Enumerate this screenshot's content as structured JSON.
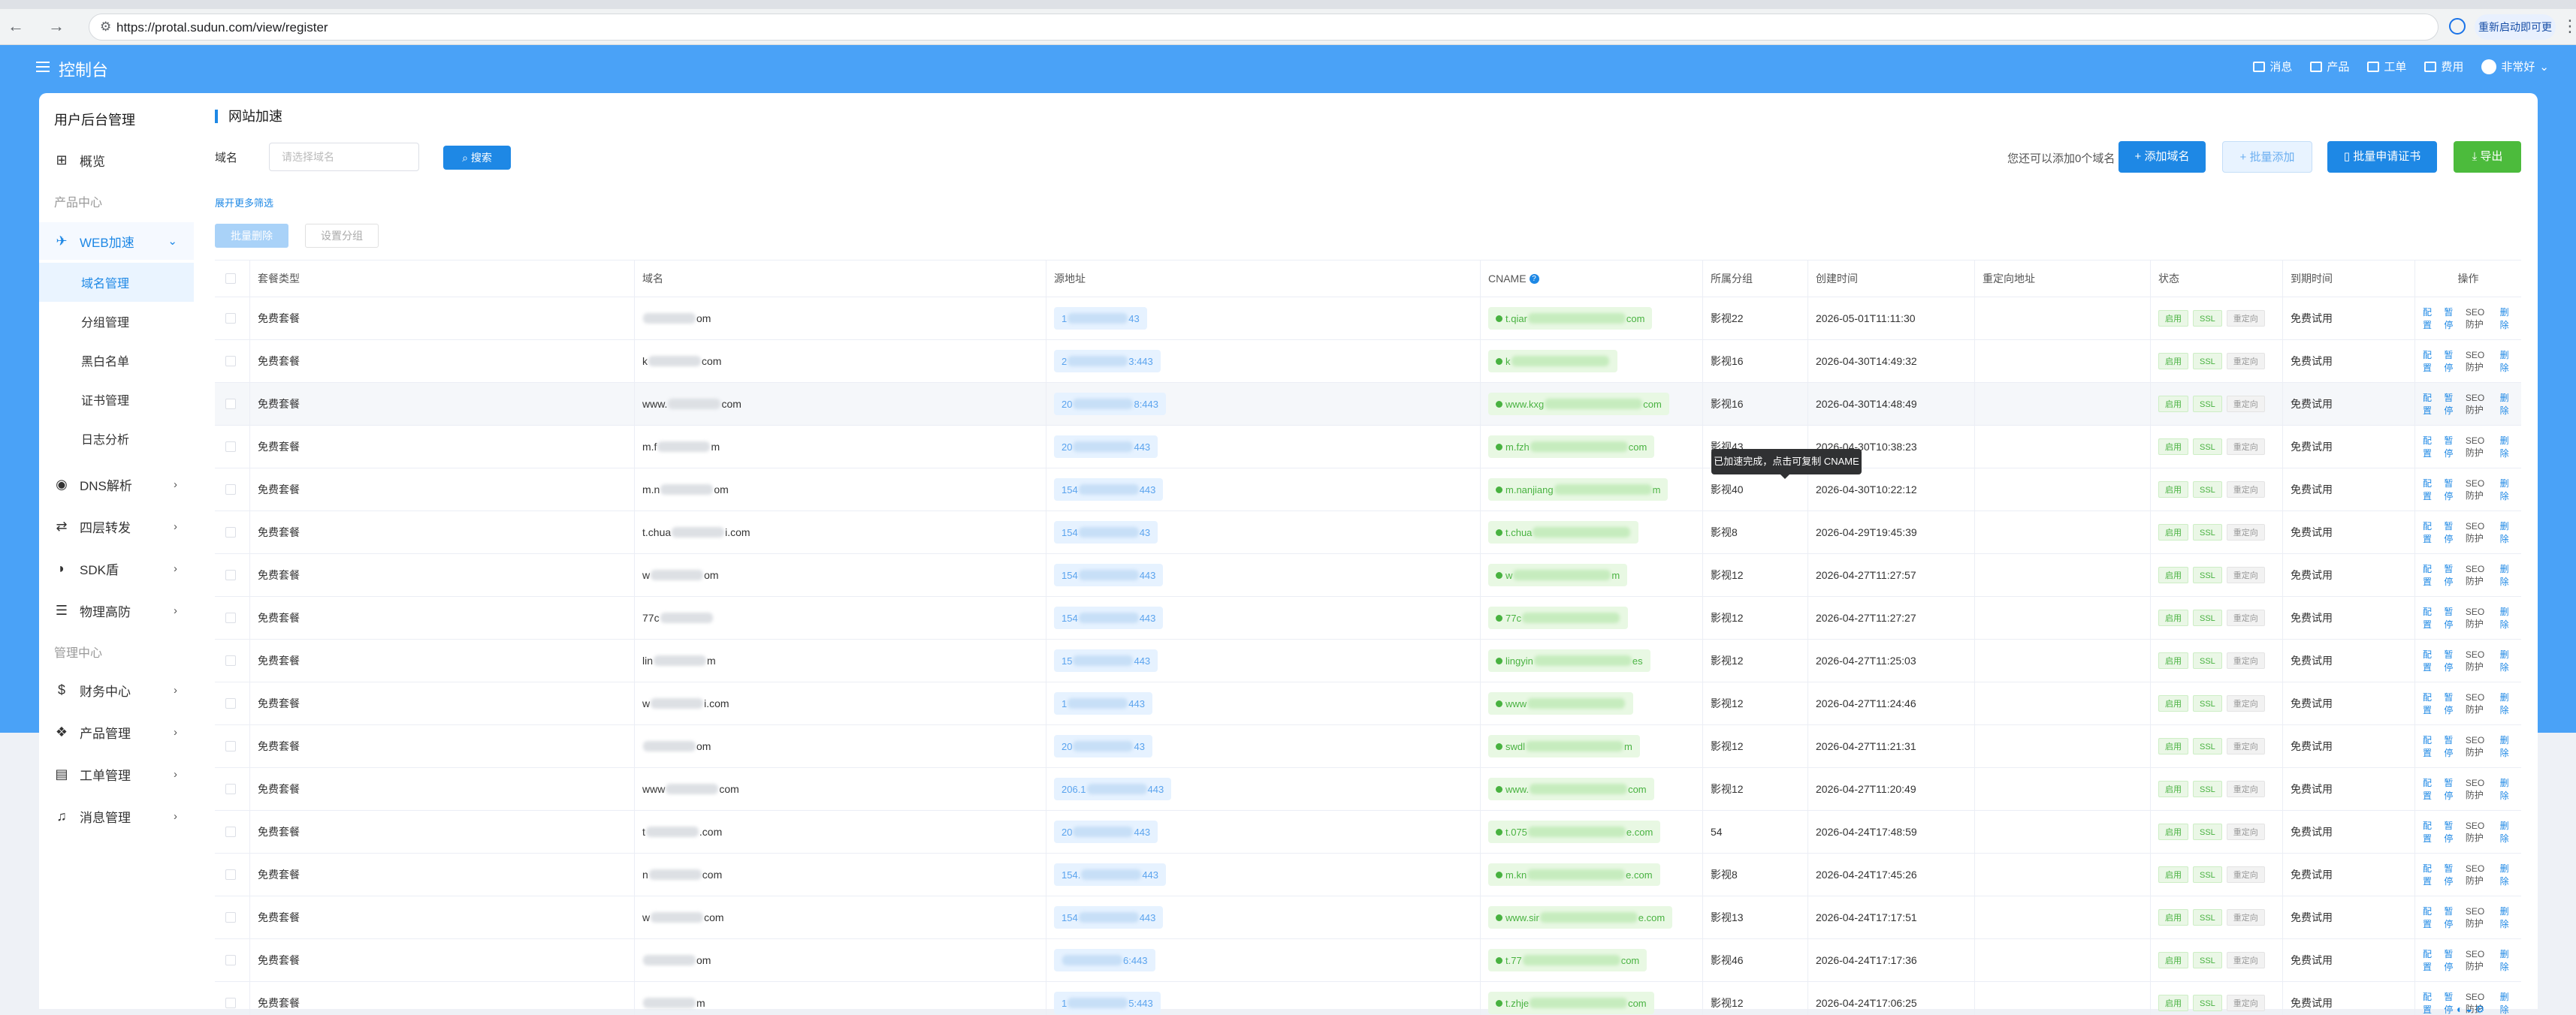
{
  "browser": {
    "url": "https://protal.sudun.com/view/register",
    "update_button": "重新启动即可更新"
  },
  "header": {
    "app_title": "控制台",
    "menu": [
      {
        "label": "消息",
        "icon": "mail-icon"
      },
      {
        "label": "产品",
        "icon": "product-icon"
      },
      {
        "label": "工单",
        "icon": "ticket-icon"
      },
      {
        "label": "费用",
        "icon": "fee-icon"
      },
      {
        "label": "非常好",
        "icon": "user-avatar"
      }
    ]
  },
  "sidebar": {
    "title": "用户后台管理",
    "overview": "概览",
    "section_products": "产品中心",
    "web_accel": "WEB加速",
    "web_sub": [
      "域名管理",
      "分组管理",
      "黑白名单",
      "证书管理",
      "日志分析"
    ],
    "dns": "DNS解析",
    "l4": "四层转发",
    "sdk": "SDK盾",
    "phys": "物理高防",
    "section_mgmt": "管理中心",
    "finance": "财务中心",
    "product_mgmt": "产品管理",
    "ticket_mgmt": "工单管理",
    "msg_mgmt": "消息管理"
  },
  "main": {
    "title": "网站加速",
    "filter_label": "域名",
    "search_placeholder": "请选择域名",
    "search_button": "搜索",
    "more_filter": "展开更多筛选",
    "quota_text": "您还可以添加0个域名",
    "add_domain": "添加域名",
    "batch_add": "批量添加",
    "batch_cert": "批量申请证书",
    "export": "导出",
    "batch_delete": "批量删除",
    "set_group": "设置分组",
    "tooltip": "已加速完成，点击可复制 CNAME"
  },
  "table": {
    "headers": [
      "套餐类型",
      "域名",
      "源地址",
      "CNAME",
      "所属分组",
      "创建时间",
      "重定向地址",
      "状态",
      "到期时间",
      "操作"
    ],
    "status_tags": [
      "启用",
      "SSL",
      "重定向"
    ],
    "ops": [
      "配置",
      "暂停",
      "SEO防护",
      "删除"
    ],
    "rows": [
      {
        "plan": "免费套餐",
        "domain_pre": "",
        "domain_suf": "om",
        "origin_pre": "1",
        "origin_suf": "43",
        "cname_pre": "t.qiar",
        "cname_suf": "com",
        "group": "影视22",
        "created": "2026-05-01T11:11:30",
        "expiry": "免费试用"
      },
      {
        "plan": "免费套餐",
        "domain_pre": "k",
        "domain_suf": "com",
        "origin_pre": "2",
        "origin_suf": "3:443",
        "cname_pre": "k",
        "cname_suf": "",
        "group": "影视16",
        "created": "2026-04-30T14:49:32",
        "expiry": "免费试用"
      },
      {
        "plan": "免费套餐",
        "domain_pre": "www.",
        "domain_suf": "com",
        "origin_pre": "20",
        "origin_suf": "8:443",
        "cname_pre": "www.kxg",
        "cname_suf": "com",
        "group": "影视16",
        "created": "2026-04-30T14:48:49",
        "expiry": "免费试用"
      },
      {
        "plan": "免费套餐",
        "domain_pre": "m.f",
        "domain_suf": "m",
        "origin_pre": "20",
        "origin_suf": "443",
        "cname_pre": "m.fzh",
        "cname_suf": "com",
        "group": "影视43",
        "created": "2026-04-30T10:38:23",
        "expiry": "免费试用"
      },
      {
        "plan": "免费套餐",
        "domain_pre": "m.n",
        "domain_suf": "om",
        "origin_pre": "154",
        "origin_suf": "443",
        "cname_pre": "m.nanjiang",
        "cname_suf": "m",
        "group": "影视40",
        "created": "2026-04-30T10:22:12",
        "expiry": "免费试用"
      },
      {
        "plan": "免费套餐",
        "domain_pre": "t.chua",
        "domain_suf": "i.com",
        "origin_pre": "154",
        "origin_suf": "43",
        "cname_pre": "t.chua",
        "cname_suf": "",
        "group": "影视8",
        "created": "2026-04-29T19:45:39",
        "expiry": "免费试用"
      },
      {
        "plan": "免费套餐",
        "domain_pre": "w",
        "domain_suf": "om",
        "origin_pre": "154",
        "origin_suf": "443",
        "cname_pre": "w",
        "cname_suf": "m",
        "group": "影视12",
        "created": "2026-04-27T11:27:57",
        "expiry": "免费试用"
      },
      {
        "plan": "免费套餐",
        "domain_pre": "77c",
        "domain_suf": "",
        "origin_pre": "154",
        "origin_suf": "443",
        "cname_pre": "77c",
        "cname_suf": "",
        "group": "影视12",
        "created": "2026-04-27T11:27:27",
        "expiry": "免费试用"
      },
      {
        "plan": "免费套餐",
        "domain_pre": "lin",
        "domain_suf": "m",
        "origin_pre": "15",
        "origin_suf": "443",
        "cname_pre": "lingyin",
        "cname_suf": "es",
        "group": "影视12",
        "created": "2026-04-27T11:25:03",
        "expiry": "免费试用"
      },
      {
        "plan": "免费套餐",
        "domain_pre": "w",
        "domain_suf": "i.com",
        "origin_pre": "1",
        "origin_suf": "443",
        "cname_pre": "www",
        "cname_suf": "",
        "group": "影视12",
        "created": "2026-04-27T11:24:46",
        "expiry": "免费试用"
      },
      {
        "plan": "免费套餐",
        "domain_pre": "",
        "domain_suf": "om",
        "origin_pre": "20",
        "origin_suf": "43",
        "cname_pre": "swdl",
        "cname_suf": "m",
        "group": "影视12",
        "created": "2026-04-27T11:21:31",
        "expiry": "免费试用"
      },
      {
        "plan": "免费套餐",
        "domain_pre": "www",
        "domain_suf": "com",
        "origin_pre": "206.1",
        "origin_suf": "443",
        "cname_pre": "www.",
        "cname_suf": "com",
        "group": "影视12",
        "created": "2026-04-27T11:20:49",
        "expiry": "免费试用"
      },
      {
        "plan": "免费套餐",
        "domain_pre": "t",
        "domain_suf": ".com",
        "origin_pre": "20",
        "origin_suf": "443",
        "cname_pre": "t.075",
        "cname_suf": "e.com",
        "group": "54",
        "created": "2026-04-24T17:48:59",
        "expiry": "免费试用"
      },
      {
        "plan": "免费套餐",
        "domain_pre": "n",
        "domain_suf": "com",
        "origin_pre": "154.",
        "origin_suf": "443",
        "cname_pre": "m.kn",
        "cname_suf": "e.com",
        "group": "影视8",
        "created": "2026-04-24T17:45:26",
        "expiry": "免费试用"
      },
      {
        "plan": "免费套餐",
        "domain_pre": "w",
        "domain_suf": "com",
        "origin_pre": "154",
        "origin_suf": "443",
        "cname_pre": "www.sir",
        "cname_suf": "e.com",
        "group": "影视13",
        "created": "2026-04-24T17:17:51",
        "expiry": "免费试用"
      },
      {
        "plan": "免费套餐",
        "domain_pre": "",
        "domain_suf": "om",
        "origin_pre": "",
        "origin_suf": "6:443",
        "cname_pre": "t.77",
        "cname_suf": "com",
        "group": "影视46",
        "created": "2026-04-24T17:17:36",
        "expiry": "免费试用"
      },
      {
        "plan": "免费套餐",
        "domain_pre": "",
        "domain_suf": "m",
        "origin_pre": "1",
        "origin_suf": "5:443",
        "cname_pre": "t.zhje",
        "cname_suf": "com",
        "group": "影视12",
        "created": "2026-04-24T17:06:25",
        "expiry": "免费试用"
      }
    ]
  }
}
